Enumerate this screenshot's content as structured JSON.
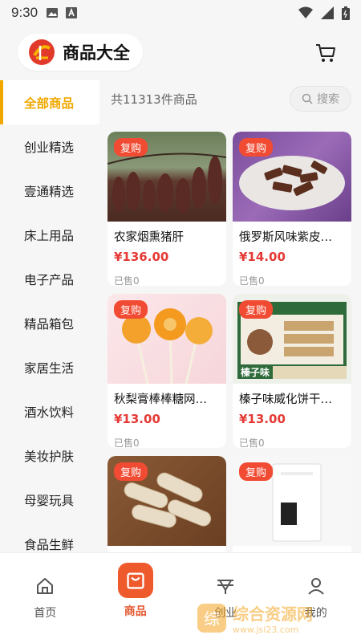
{
  "status": {
    "time": "9:30"
  },
  "header": {
    "title": "商品大全"
  },
  "sidebar": {
    "items": [
      {
        "label": "全部商品",
        "active": true
      },
      {
        "label": "创业精选"
      },
      {
        "label": "壹通精选"
      },
      {
        "label": "床上用品"
      },
      {
        "label": "电子产品"
      },
      {
        "label": "精品箱包"
      },
      {
        "label": "家居生活"
      },
      {
        "label": "酒水饮料"
      },
      {
        "label": "美妆护肤"
      },
      {
        "label": "母婴玩具"
      },
      {
        "label": "食品生鲜"
      }
    ]
  },
  "main": {
    "count_text": "共11313件商品",
    "search_placeholder": "搜索",
    "products": [
      {
        "badge": "复购",
        "name": "农家烟熏猪肝",
        "price": "¥136.00",
        "sold": "已售0"
      },
      {
        "badge": "复购",
        "name": "俄罗斯风味紫皮…",
        "price": "¥14.00",
        "sold": "已售0"
      },
      {
        "badge": "复购",
        "name": "秋梨膏棒棒糖网…",
        "price": "¥13.00",
        "sold": "已售0"
      },
      {
        "badge": "复购",
        "name": "榛子味威化饼干…",
        "price": "¥13.00",
        "sold": "已售0",
        "image_text": "榛子味"
      },
      {
        "badge": "复购",
        "name": "",
        "price": "",
        "sold": ""
      },
      {
        "badge": "复购",
        "name": "",
        "price": "",
        "sold": ""
      }
    ]
  },
  "tabbar": {
    "items": [
      {
        "label": "首页",
        "icon": "home-icon"
      },
      {
        "label": "商品",
        "icon": "bag-icon",
        "active": true
      },
      {
        "label": "创业",
        "icon": "startup-icon"
      },
      {
        "label": "我的",
        "icon": "user-icon"
      }
    ]
  },
  "watermark": {
    "text": "综合资源网",
    "sub": "www.jsi23.com"
  },
  "colors": {
    "accent": "#f0a800",
    "price": "#e53935",
    "active_tab": "#ef5a2c",
    "badge": "#f14b33"
  }
}
